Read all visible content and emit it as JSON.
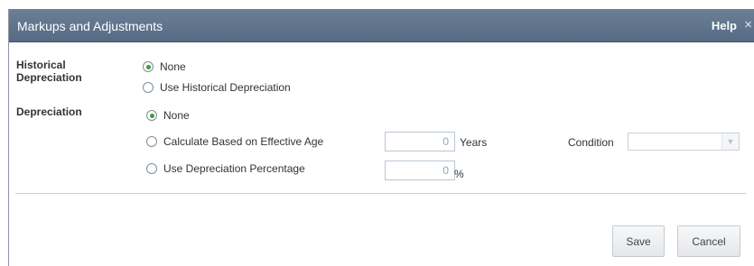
{
  "dialog": {
    "title": "Markups and Adjustments",
    "help_label": "Help",
    "close_glyph": "×"
  },
  "historical_depreciation": {
    "label_line1": "Historical",
    "label_line2": "Depreciation",
    "options": [
      {
        "label": "None",
        "selected": true
      },
      {
        "label": "Use Historical Depreciation",
        "selected": false
      }
    ]
  },
  "depreciation": {
    "label": "Depreciation",
    "options": [
      {
        "label": "None",
        "selected": true
      },
      {
        "label": "Calculate Based on Effective Age",
        "selected": false
      },
      {
        "label": "Use Depreciation Percentage",
        "selected": false
      }
    ],
    "effective_age": {
      "value": "0",
      "unit": "Years"
    },
    "percentage": {
      "value": "0",
      "unit": "%"
    },
    "condition": {
      "label": "Condition",
      "selected_value": ""
    }
  },
  "buttons": {
    "save": "Save",
    "cancel": "Cancel"
  },
  "colors": {
    "titlebar": "#5f738b",
    "radio_selected": "#3a9b3a",
    "input_border": "#b9c7d6"
  }
}
